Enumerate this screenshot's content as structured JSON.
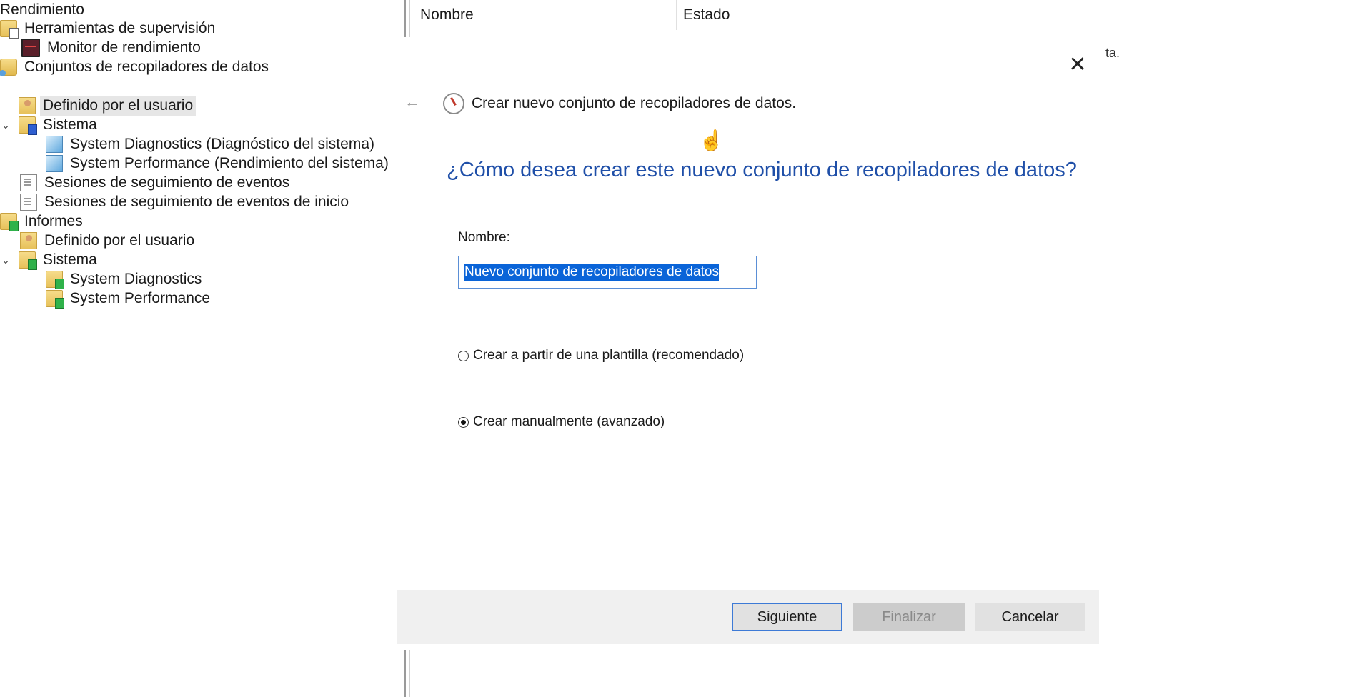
{
  "tree": {
    "items": [
      {
        "label": "Rendimiento"
      },
      {
        "label": "Herramientas de supervisión"
      },
      {
        "label": "Monitor de rendimiento"
      },
      {
        "label": "Conjuntos de recopiladores de datos"
      },
      {
        "label": "Definido por el usuario"
      },
      {
        "label": "Sistema"
      },
      {
        "label": "System Diagnostics (Diagnóstico del sistema)"
      },
      {
        "label": "System Performance (Rendimiento del sistema)"
      },
      {
        "label": "Sesiones de seguimiento de eventos"
      },
      {
        "label": "Sesiones de seguimiento de eventos de inicio"
      },
      {
        "label": "Informes"
      },
      {
        "label": "Definido por el usuario"
      },
      {
        "label": "Sistema"
      },
      {
        "label": "System Diagnostics"
      },
      {
        "label": "System Performance"
      }
    ]
  },
  "list": {
    "columns": [
      "Nombre",
      "Estado"
    ],
    "behind_text": "ta."
  },
  "dialog": {
    "title": "Crear nuevo conjunto de recopiladores de datos.",
    "heading": "¿Cómo desea crear este nuevo conjunto de recopiladores de datos?",
    "name_label": "Nombre:",
    "name_value": "Nuevo conjunto de recopiladores de datos",
    "options": [
      {
        "label": "Crear a partir de una plantilla (recomendado)",
        "checked": false
      },
      {
        "label": "Crear manualmente (avanzado)",
        "checked": true
      }
    ],
    "buttons": {
      "next": "Siguiente",
      "finish": "Finalizar",
      "cancel": "Cancelar"
    }
  },
  "icons": {
    "close": "close-icon",
    "back": "back-arrow-icon",
    "wizard": "performance-gauge-icon",
    "cursor": "hand-cursor-icon"
  },
  "colors": {
    "heading": "#1f4fa8",
    "selection": "#0a64d8",
    "default_button_border": "#3d7ad6",
    "footer_bg": "#f0f0f0"
  }
}
